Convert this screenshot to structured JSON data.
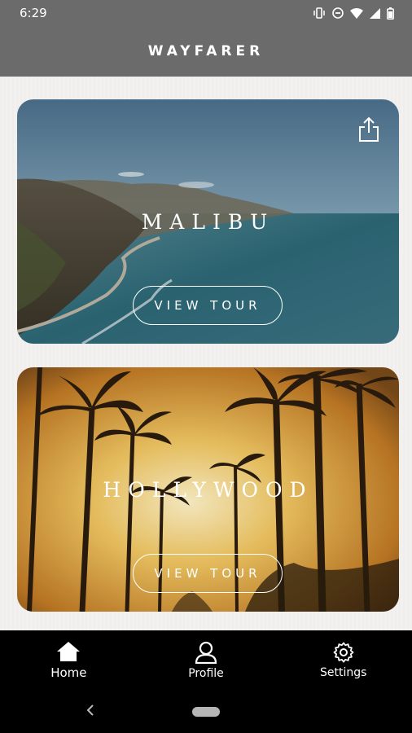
{
  "status_bar": {
    "time": "6:29",
    "icons": [
      "vibrate-icon",
      "dnd-icon",
      "wifi-icon",
      "signal-icon",
      "battery-icon"
    ]
  },
  "header": {
    "title": "WAYFARER"
  },
  "cards": [
    {
      "title": "MALIBU",
      "button_label": "VIEW TOUR",
      "share_icon": "share-icon"
    },
    {
      "title": "HOLLYWOOD",
      "button_label": "VIEW TOUR"
    }
  ],
  "bottom_nav": {
    "items": [
      {
        "label": "Home",
        "icon": "home-icon",
        "active": true
      },
      {
        "label": "Profile",
        "icon": "profile-icon",
        "active": false
      },
      {
        "label": "Settings",
        "icon": "gear-icon",
        "active": false
      }
    ]
  },
  "colors": {
    "header_bg": "#6b6b6b",
    "content_bg": "#f2f1ef",
    "nav_bg": "#000000",
    "text_light": "#ffffff"
  }
}
